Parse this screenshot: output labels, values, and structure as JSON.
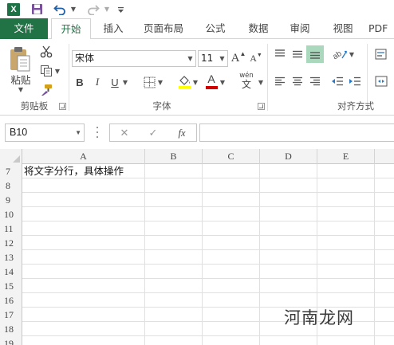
{
  "qat": {
    "app_icon": "excel-logo-icon",
    "app_icon_letter": "X",
    "save_icon": "save-icon",
    "undo_icon": "undo-icon",
    "redo_icon": "redo-icon",
    "customize_icon": "customize-qat-icon"
  },
  "tabs": {
    "file": "文件",
    "home": "开始",
    "insert": "插入",
    "page_layout": "页面布局",
    "formulas": "公式",
    "data": "数据",
    "review": "审阅",
    "view": "视图",
    "pdf": "PDF"
  },
  "ribbon": {
    "clipboard": {
      "label": "剪贴板",
      "paste_label": "粘贴"
    },
    "font": {
      "label": "字体",
      "font_name": "宋体",
      "font_size": "11",
      "grow_glyph": "A",
      "shrink_glyph": "A",
      "bold_glyph": "B",
      "italic_glyph": "I",
      "underline_glyph": "U",
      "font_color_glyph": "A",
      "phonetic_top": "wén",
      "phonetic_bottom": "文",
      "fill_color": "#ffff00",
      "font_color": "#d00000"
    },
    "alignment": {
      "label": "对齐方式"
    }
  },
  "formula_bar": {
    "name_box": "B10",
    "cancel_glyph": "✕",
    "enter_glyph": "✓",
    "fx_glyph": "fx",
    "formula": ""
  },
  "grid": {
    "columns": [
      "A",
      "B",
      "C",
      "D",
      "E"
    ],
    "rows": [
      {
        "num": "7",
        "a": "将文字分行，具体操作"
      },
      {
        "num": "8",
        "a": ""
      },
      {
        "num": "9",
        "a": ""
      },
      {
        "num": "10",
        "a": ""
      },
      {
        "num": "11",
        "a": ""
      },
      {
        "num": "12",
        "a": ""
      },
      {
        "num": "13",
        "a": ""
      },
      {
        "num": "14",
        "a": ""
      },
      {
        "num": "15",
        "a": ""
      },
      {
        "num": "16",
        "a": ""
      },
      {
        "num": "17",
        "a": ""
      },
      {
        "num": "18",
        "a": ""
      },
      {
        "num": "19",
        "a": ""
      }
    ]
  },
  "watermark": "河南龙网",
  "colors": {
    "excel_green": "#217346",
    "ribbon_border": "#d4d4d4",
    "header_bg": "#f3f3f3"
  }
}
